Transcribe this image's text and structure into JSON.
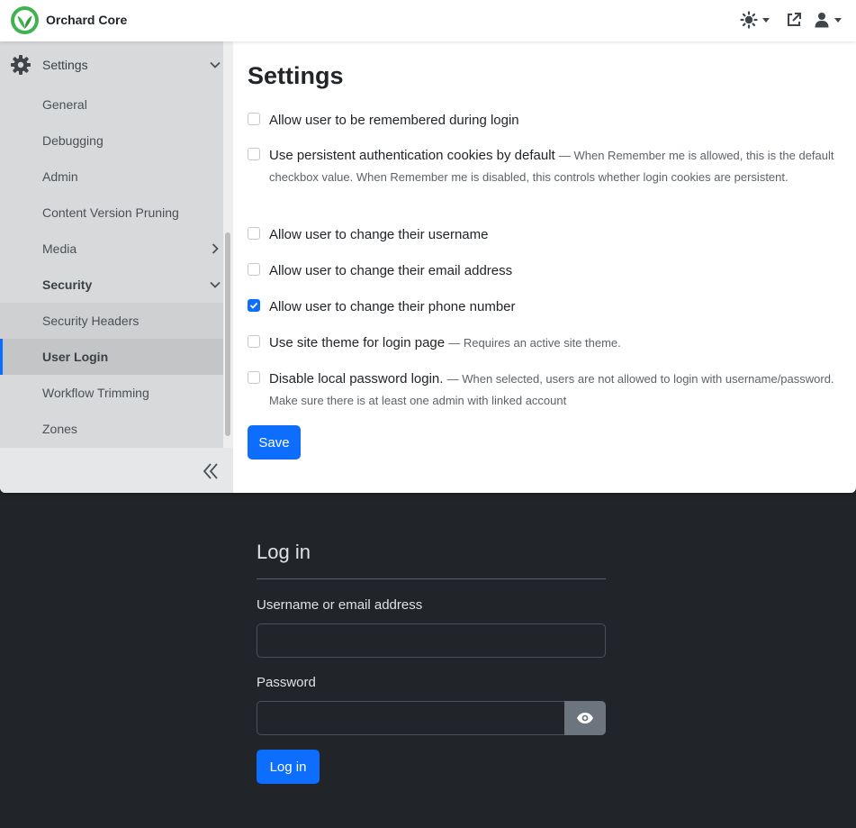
{
  "app": {
    "name": "Orchard Core"
  },
  "header": {
    "icons": [
      "theme-toggle-icon",
      "external-link-icon",
      "user-icon"
    ]
  },
  "sidebar": {
    "root": {
      "label": "Settings"
    },
    "items": [
      {
        "label": "General"
      },
      {
        "label": "Debugging"
      },
      {
        "label": "Admin"
      },
      {
        "label": "Content Version Pruning"
      },
      {
        "label": "Media"
      },
      {
        "label": "Security"
      },
      {
        "label": "Security Headers"
      },
      {
        "label": "User Login"
      },
      {
        "label": "Workflow Trimming"
      },
      {
        "label": "Zones"
      }
    ]
  },
  "main": {
    "title": "Settings",
    "options": [
      {
        "label": "Allow user to be remembered during login",
        "hint": "",
        "checked": false
      },
      {
        "label": "Use persistent authentication cookies by default",
        "hint": "— When Remember me is allowed, this is the default checkbox value. When Remember me is disabled, this controls whether login cookies are persistent.",
        "checked": false
      },
      {
        "label": "Allow user to change their username",
        "hint": "",
        "checked": false
      },
      {
        "label": "Allow user to change their email address",
        "hint": "",
        "checked": false
      },
      {
        "label": "Allow user to change their phone number",
        "hint": "",
        "checked": true
      },
      {
        "label": "Use site theme for login page",
        "hint": "— Requires an active site theme.",
        "checked": false
      },
      {
        "label": "Disable local password login.",
        "hint": "— When selected, users are not allowed to login with username/password. Make sure there is at least one admin with linked account",
        "checked": false
      }
    ],
    "save_label": "Save"
  },
  "login": {
    "title": "Log in",
    "username_label": "Username or email address",
    "username_value": "",
    "password_label": "Password",
    "password_value": "",
    "submit_label": "Log in"
  },
  "colors": {
    "primary": "#0d6efd",
    "dark_bg": "#212529",
    "brand_green": "#3fb34f"
  }
}
